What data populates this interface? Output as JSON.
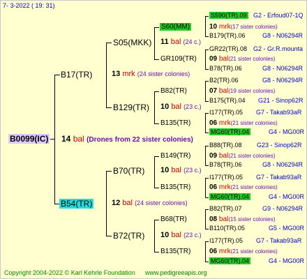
{
  "date": "7-  3-2022 (  19:  31)",
  "footer": {
    "copyright": "Copyright 2004-2022 © Karl Kehrle Foundation",
    "website": "www.pedigreeapis.org"
  },
  "root": {
    "name": "B0099(IC)",
    "num": "14",
    "mark": "bal",
    "note": "(Drones from 22 sister colonies)"
  },
  "g1": {
    "sire": {
      "name": "B17(TR)",
      "num": "13",
      "mark": "mrk",
      "note": "(24 sister colonies)"
    },
    "dam": {
      "name": "B54(TR)",
      "num": "12",
      "mark": "bal",
      "note": "(24 sister colonies)"
    }
  },
  "g2": [
    {
      "name": "S05(MKK)",
      "num": "11",
      "mark": "bal",
      "note": "(24 c.)"
    },
    {
      "name": "B129(TR)",
      "num": "10",
      "mark": "bal",
      "note": "(23 c.)"
    },
    {
      "name": "B70(TR)",
      "num": "10",
      "mark": "bal",
      "note": "(23 c.)"
    },
    {
      "name": "B72(TR)",
      "num": "10",
      "mark": "bal",
      "note": "(23 c.)"
    }
  ],
  "g3": [
    {
      "name": "S60(MM)",
      "num": "10",
      "mark": "mrk",
      "note": "(17 sister colonies)"
    },
    {
      "name": "GR109(TR)",
      "num": "09",
      "mark": "bal",
      "note": "(21 sister colonies)"
    },
    {
      "name": "B82(TR)",
      "num": "07",
      "mark": "bal",
      "note": "(19 sister colonies)"
    },
    {
      "name": "B135(TR)",
      "num": "06",
      "mark": "mrk",
      "note": "(21 sister colonies)"
    },
    {
      "name": "B149(TR)",
      "num": "09",
      "mark": "bal",
      "note": "(21 sister colonies)"
    },
    {
      "name": "B135(TR)",
      "num": "06",
      "mark": "mrk",
      "note": "(21 sister colonies)"
    },
    {
      "name": "B68(TR)",
      "num": "08",
      "mark": "bal",
      "note": "(15 sister colonies)"
    },
    {
      "name": "B135(TR)",
      "num": "06",
      "mark": "mrk",
      "note": "(21 sister colonies)"
    }
  ],
  "g4": [
    {
      "name": "S590(TR).09",
      "group": "G2 - Erfoud07-1Q"
    },
    {
      "name": "B179(TR).06",
      "group": "G8 - N06294R"
    },
    {
      "name": "GR22(TR).08",
      "group": "G2 - Gr.R.mounta"
    },
    {
      "name": "B78(TR).06",
      "group": "G8 - N06294R"
    },
    {
      "name": "B2(TR).06",
      "group": "G8 - N06294R"
    },
    {
      "name": "B175(TR).04",
      "group": "G21 - Sinop62R"
    },
    {
      "name": "I177(TR).05",
      "group": "G7 - Takab93aR"
    },
    {
      "name": "MG60(TR).04",
      "group": "G4 - MG00R"
    },
    {
      "name": "B88(TR).08",
      "group": "G23 - Sinop62R"
    },
    {
      "name": "B78(TR).06",
      "group": "G8 - N06294R"
    },
    {
      "name": "I177(TR).05",
      "group": "G7 - Takab93aR"
    },
    {
      "name": "MG60(TR).04",
      "group": "G4 - MG00R"
    },
    {
      "name": "B82(TR).07",
      "group": "G9 - N06294R"
    },
    {
      "name": "B110(TR).05",
      "group": "G5 - MG00R"
    },
    {
      "name": "I177(TR).05",
      "group": "G7 - Takab93aR"
    },
    {
      "name": "MG60(TR).04",
      "group": "G4 - MG00R"
    }
  ]
}
